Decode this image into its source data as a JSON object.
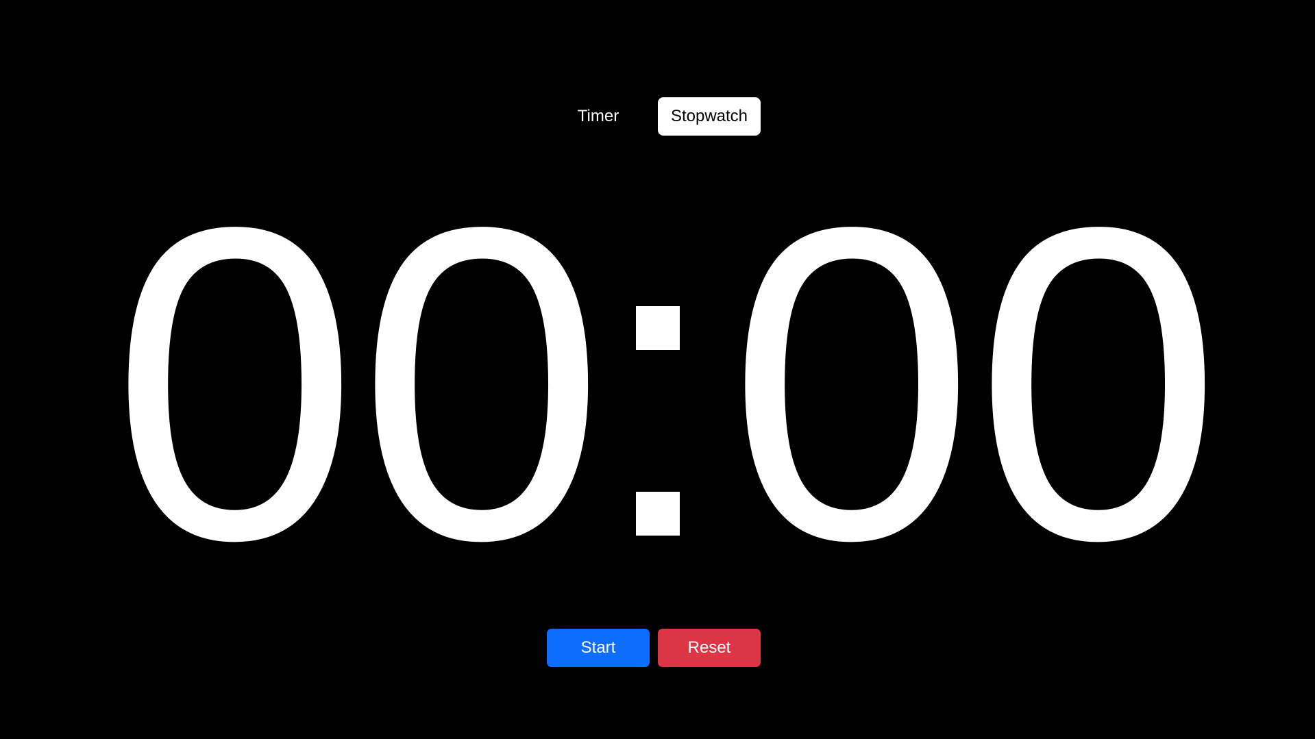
{
  "modes": {
    "timer_label": "Timer",
    "stopwatch_label": "Stopwatch",
    "active": "Stopwatch"
  },
  "display": {
    "time": "00:00",
    "minutes_tens": "0",
    "minutes_ones": "0",
    "separator": ":",
    "seconds_tens": "0",
    "seconds_ones": "0"
  },
  "controls": {
    "start_label": "Start",
    "reset_label": "Reset"
  },
  "colors": {
    "background": "#000000",
    "text": "#ffffff",
    "active_mode_bg": "#ffffff",
    "start": "#0d6efd",
    "reset": "#dc3545"
  }
}
